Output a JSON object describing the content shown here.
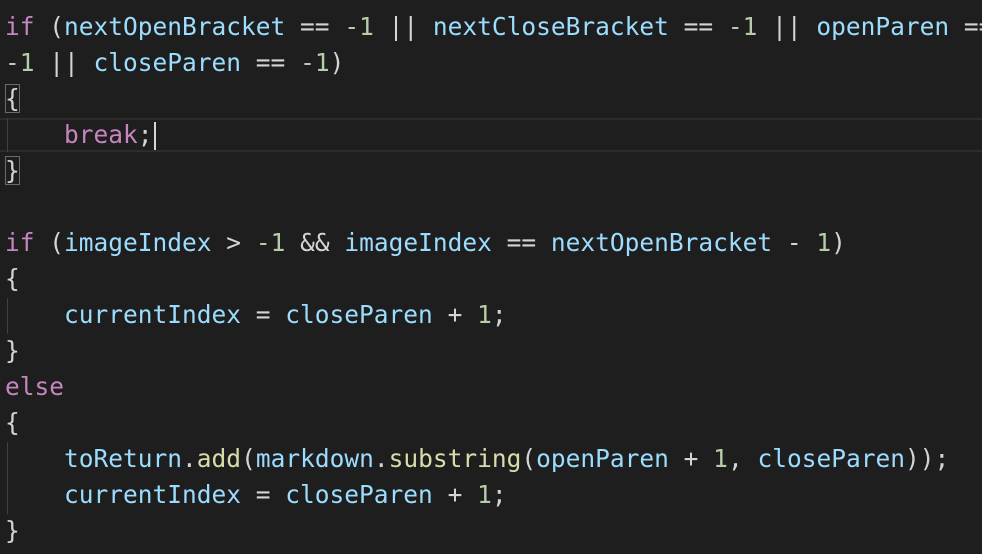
{
  "lines": [
    {
      "tokens": [
        {
          "t": "if",
          "c": "kw"
        },
        {
          "t": " (",
          "c": "op"
        },
        {
          "t": "nextOpenBracket",
          "c": "var"
        },
        {
          "t": " == ",
          "c": "op"
        },
        {
          "t": "-1",
          "c": "num"
        },
        {
          "t": " || ",
          "c": "op"
        },
        {
          "t": "nextCloseBracket",
          "c": "var"
        },
        {
          "t": " == ",
          "c": "op"
        },
        {
          "t": "-1",
          "c": "num"
        },
        {
          "t": " || ",
          "c": "op"
        },
        {
          "t": "openParen",
          "c": "var"
        },
        {
          "t": " ==",
          "c": "op"
        }
      ]
    },
    {
      "tokens": [
        {
          "t": "-1",
          "c": "num"
        },
        {
          "t": " || ",
          "c": "op"
        },
        {
          "t": "closeParen",
          "c": "var"
        },
        {
          "t": " == ",
          "c": "op"
        },
        {
          "t": "-1",
          "c": "num"
        },
        {
          "t": ")",
          "c": "op"
        }
      ]
    },
    {
      "tokens": [
        {
          "t": "{",
          "c": "op",
          "match": true
        }
      ]
    },
    {
      "cursor": true,
      "tokens": [
        {
          "t": "    ",
          "c": "op"
        },
        {
          "t": "break",
          "c": "kw"
        },
        {
          "t": ";",
          "c": "op"
        }
      ]
    },
    {
      "tokens": [
        {
          "t": "}",
          "c": "op",
          "match": true
        }
      ]
    },
    {
      "tokens": []
    },
    {
      "tokens": [
        {
          "t": "if",
          "c": "kw"
        },
        {
          "t": " (",
          "c": "op"
        },
        {
          "t": "imageIndex",
          "c": "var"
        },
        {
          "t": " > ",
          "c": "op"
        },
        {
          "t": "-1",
          "c": "num"
        },
        {
          "t": " && ",
          "c": "op"
        },
        {
          "t": "imageIndex",
          "c": "var"
        },
        {
          "t": " == ",
          "c": "op"
        },
        {
          "t": "nextOpenBracket",
          "c": "var"
        },
        {
          "t": " - ",
          "c": "op"
        },
        {
          "t": "1",
          "c": "num"
        },
        {
          "t": ")",
          "c": "op"
        }
      ]
    },
    {
      "tokens": [
        {
          "t": "{",
          "c": "op"
        }
      ]
    },
    {
      "tokens": [
        {
          "t": "    ",
          "c": "op"
        },
        {
          "t": "currentIndex",
          "c": "var"
        },
        {
          "t": " = ",
          "c": "op"
        },
        {
          "t": "closeParen",
          "c": "var"
        },
        {
          "t": " + ",
          "c": "op"
        },
        {
          "t": "1",
          "c": "num"
        },
        {
          "t": ";",
          "c": "op"
        }
      ]
    },
    {
      "tokens": [
        {
          "t": "}",
          "c": "op"
        }
      ]
    },
    {
      "tokens": [
        {
          "t": "else",
          "c": "kw"
        }
      ]
    },
    {
      "tokens": [
        {
          "t": "{",
          "c": "op"
        }
      ]
    },
    {
      "tokens": [
        {
          "t": "    ",
          "c": "op"
        },
        {
          "t": "toReturn",
          "c": "var"
        },
        {
          "t": ".",
          "c": "op"
        },
        {
          "t": "add",
          "c": "fn"
        },
        {
          "t": "(",
          "c": "op"
        },
        {
          "t": "markdown",
          "c": "var"
        },
        {
          "t": ".",
          "c": "op"
        },
        {
          "t": "substring",
          "c": "fn"
        },
        {
          "t": "(",
          "c": "op"
        },
        {
          "t": "openParen",
          "c": "var"
        },
        {
          "t": " + ",
          "c": "op"
        },
        {
          "t": "1",
          "c": "num"
        },
        {
          "t": ", ",
          "c": "op"
        },
        {
          "t": "closeParen",
          "c": "var"
        },
        {
          "t": "));",
          "c": "op"
        }
      ]
    },
    {
      "tokens": [
        {
          "t": "    ",
          "c": "op"
        },
        {
          "t": "currentIndex",
          "c": "var"
        },
        {
          "t": " = ",
          "c": "op"
        },
        {
          "t": "closeParen",
          "c": "var"
        },
        {
          "t": " + ",
          "c": "op"
        },
        {
          "t": "1",
          "c": "num"
        },
        {
          "t": ";",
          "c": "op"
        }
      ]
    },
    {
      "tokens": [
        {
          "t": "}",
          "c": "op"
        }
      ]
    }
  ]
}
